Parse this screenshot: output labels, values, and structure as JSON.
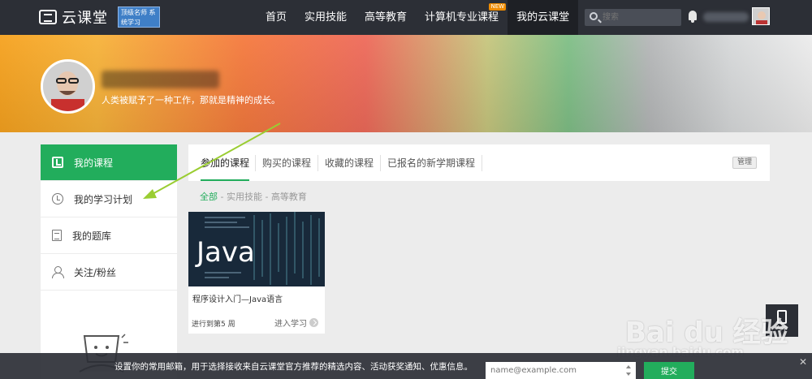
{
  "topnav": {
    "logo_text": "云课堂",
    "promo_text": "顶级名师 系统学习",
    "items": [
      {
        "label": "首页"
      },
      {
        "label": "实用技能"
      },
      {
        "label": "高等教育"
      },
      {
        "label": "计算机专业课程",
        "badge": "NEW"
      },
      {
        "label": "我的云课堂",
        "active": true
      }
    ],
    "search_placeholder": "搜索"
  },
  "profile": {
    "motto": "人类被赋予了一种工作，那就是精神的成长。"
  },
  "sidebar": {
    "items": [
      {
        "label": "我的课程",
        "icon": "course-icon",
        "active": true
      },
      {
        "label": "我的学习计划",
        "icon": "clock-icon"
      },
      {
        "label": "我的题库",
        "icon": "document-icon"
      },
      {
        "label": "关注/粉丝",
        "icon": "user-icon"
      }
    ]
  },
  "tabs": {
    "items": [
      {
        "label": "参加的课程",
        "active": true
      },
      {
        "label": "购买的课程"
      },
      {
        "label": "收藏的课程"
      },
      {
        "label": "已报名的新学期课程"
      }
    ],
    "manage_label": "管理"
  },
  "filter": {
    "all": "全部",
    "rest": " - 实用技能 - 高等教育"
  },
  "course": {
    "thumb_text": "Java",
    "title": "程序设计入门—Java语言",
    "progress": "进行到第5 周",
    "enter_label": "进入学习"
  },
  "app_button": {
    "label": "App"
  },
  "watermark": {
    "main": "Bai du 经验",
    "sub": "jingyan.baidu.com"
  },
  "subscribe": {
    "text": "设置你的常用邮箱，用于选择接收来自云课堂官方推荐的精选内容、活动获奖通知、优惠信息。",
    "placeholder": "name@example.com",
    "submit_label": "提交",
    "close_label": "✕"
  },
  "colors": {
    "accent": "#22ad5c",
    "nav_bg": "#2c2f36"
  }
}
